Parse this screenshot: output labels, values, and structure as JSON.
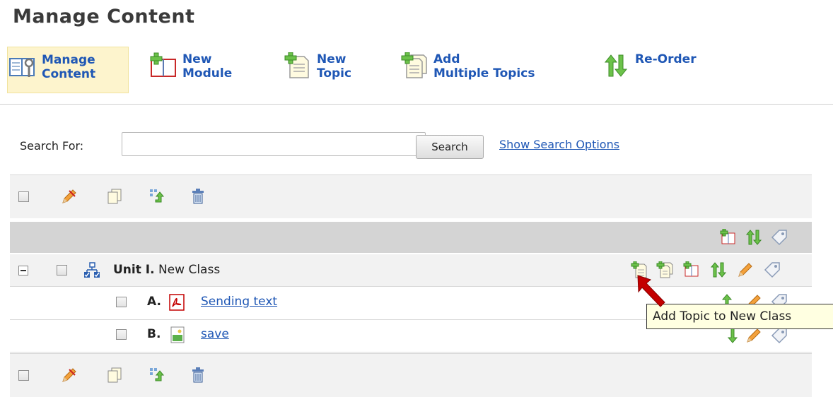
{
  "page": {
    "title": "Manage Content"
  },
  "toolbar": {
    "items": [
      {
        "label": "Manage\nContent",
        "icon": "book-wrench-icon"
      },
      {
        "label": "New\nModule",
        "icon": "new-module-icon"
      },
      {
        "label": "New\nTopic",
        "icon": "new-topic-icon"
      },
      {
        "label": "Add\nMultiple Topics",
        "icon": "multiple-topics-icon"
      },
      {
        "label": "Re-Order",
        "icon": "reorder-arrows-icon"
      }
    ]
  },
  "search": {
    "label": "Search For:",
    "value": "",
    "button": "Search",
    "options_link": "Show Search Options"
  },
  "tree": {
    "unit": {
      "prefix": "Unit I.",
      "title": "New Class"
    },
    "topics": [
      {
        "letter": "A.",
        "title": "Sending text",
        "type_icon": "pdf-file-icon"
      },
      {
        "letter": "B.",
        "title": "save",
        "type_icon": "image-file-icon"
      }
    ]
  },
  "tooltip": {
    "text": "Add Topic to New Class"
  },
  "colors": {
    "link": "#1f57b5",
    "active_toolbar_bg": "#fdf4cd",
    "header_bar": "#d4d4d4",
    "arrow_green": "#3aa334",
    "red_arrow": "#c40000"
  }
}
